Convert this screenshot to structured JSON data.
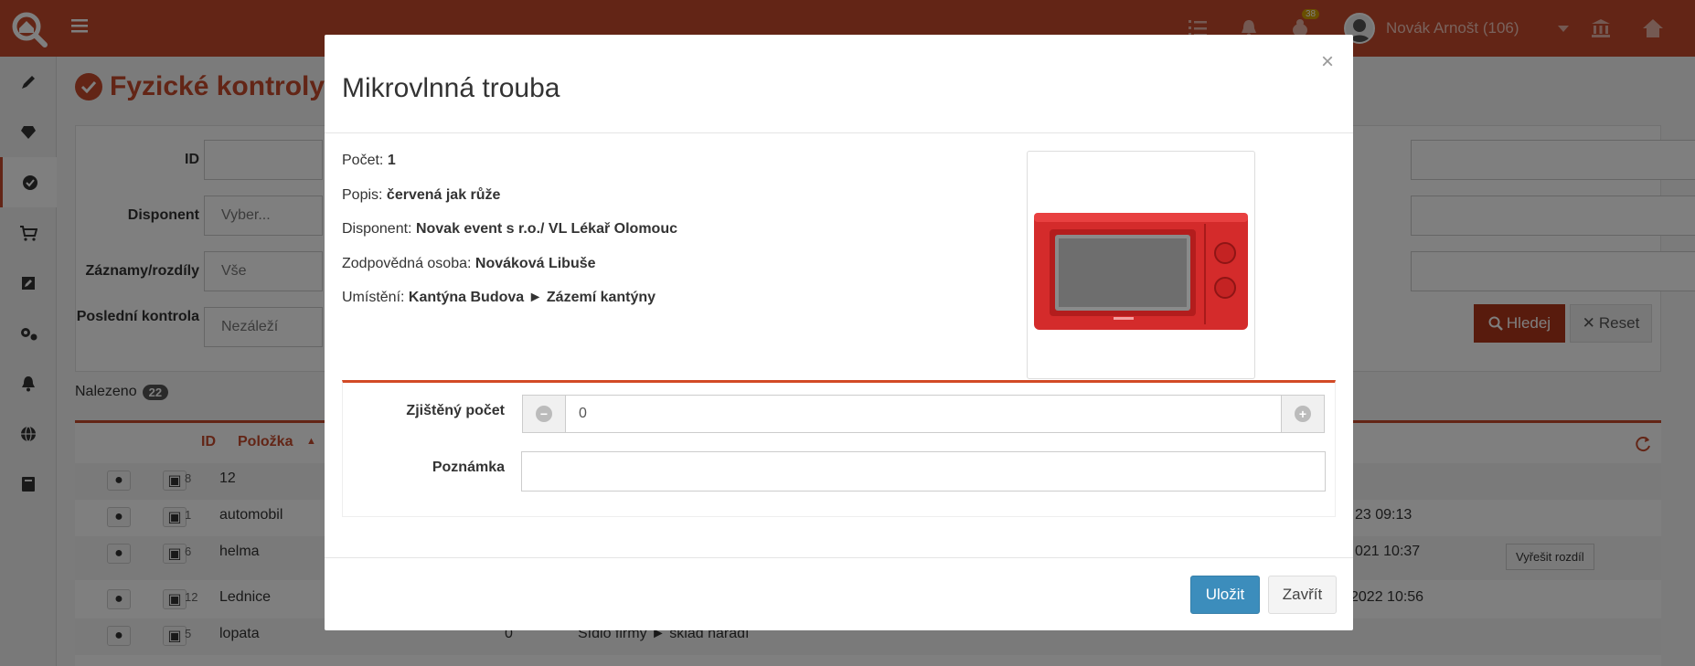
{
  "topbar": {
    "user_name": "Novák Arnošt (106)",
    "notification_count": "38"
  },
  "page": {
    "title": "Fyzické kontroly",
    "filters": {
      "id_label": "ID",
      "disponent_label": "Disponent",
      "disponent_placeholder": "Vyber...",
      "records_label": "Záznamy/rozdíly",
      "records_value": "Vše",
      "last_check_label": "Poslední kontrola",
      "last_check_value": "Nezáleží"
    },
    "search_button": "Hledej",
    "reset_button": "Reset",
    "found_label": "Nalezeno",
    "found_count": "22",
    "table": {
      "col_id": "ID",
      "col_item": "Položka",
      "rows": [
        {
          "id": "8",
          "name": "12",
          "extra": ""
        },
        {
          "id": "1",
          "name": "automobil",
          "extra": "23 09:13"
        },
        {
          "id": "6",
          "name": "helma",
          "extra": "021 10:37",
          "action": "Vyřešit rozdíl"
        },
        {
          "id": "12",
          "name": "Lednice",
          "extra": "2022 10:56"
        },
        {
          "id": "5",
          "name": "lopata",
          "count": "0",
          "location": "Sídlo firmy ► sklad nářadí"
        }
      ]
    }
  },
  "modal": {
    "title": "Mikrovlnná trouba",
    "count_label": "Počet:",
    "count_value": "1",
    "desc_label": "Popis:",
    "desc_value": "červená jak růže",
    "disponent_label": "Disponent:",
    "disponent_value": "Novak event s r.o./ VL Lékař Olomouc",
    "responsible_label": "Zodpovědná osoba:",
    "responsible_value": "Nováková Libuše",
    "location_label": "Umístění:",
    "location_value": "Kantýna Budova ► Zázemí kantýny",
    "found_count_label": "Zjištěný počet",
    "found_count_value": "0",
    "note_label": "Poznámka",
    "note_value": "",
    "save_button": "Uložit",
    "close_button": "Zavřít",
    "close_icon": "×"
  },
  "colors": {
    "brand": "#c64a2c",
    "primary_button": "#3c8dbc",
    "search_button": "#b0371a"
  }
}
